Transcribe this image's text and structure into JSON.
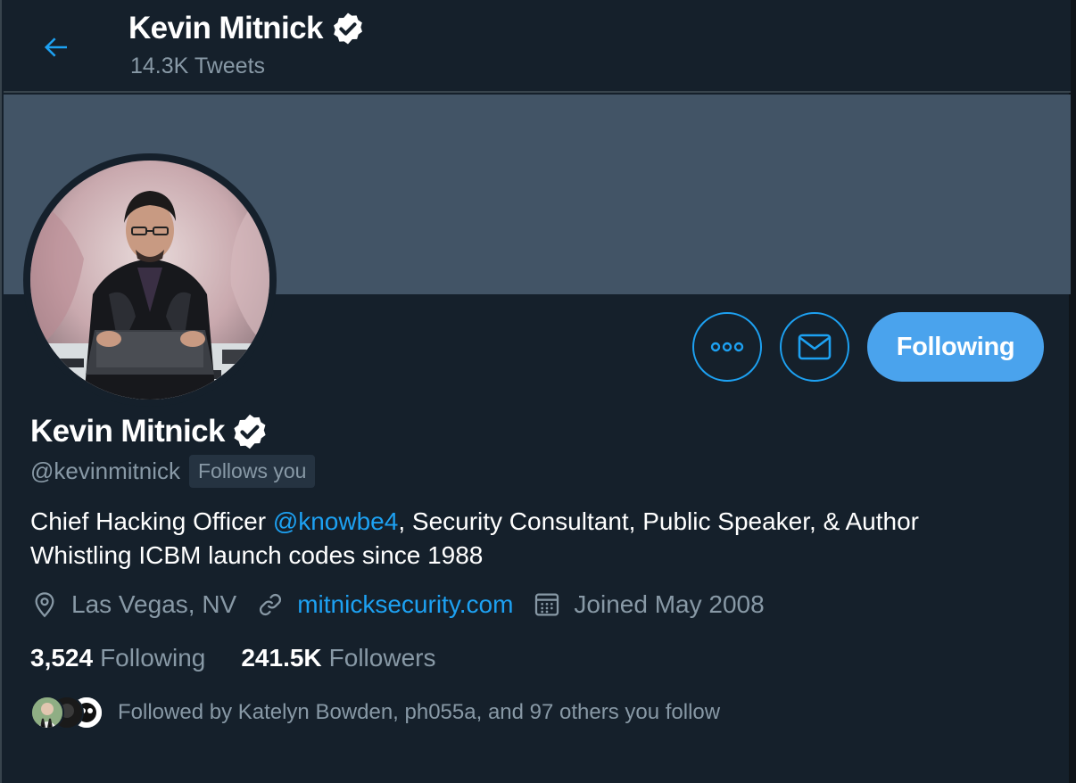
{
  "header": {
    "name": "Kevin Mitnick",
    "tweets": "14.3K Tweets"
  },
  "actions": {
    "follow_label": "Following"
  },
  "profile": {
    "name": "Kevin Mitnick",
    "handle": "@kevinmitnick",
    "follows_you": "Follows you",
    "bio_before": "Chief Hacking Officer ",
    "bio_mention": "@knowbe4",
    "bio_after": ", Security Consultant, Public Speaker, & Author",
    "bio_line2": "Whistling ICBM launch codes since 1988",
    "location": "Las Vegas, NV",
    "website": "mitnicksecurity.com",
    "joined": "Joined May 2008"
  },
  "stats": {
    "following_count": "3,524",
    "following_label": "Following",
    "followers_count": "241.5K",
    "followers_label": "Followers"
  },
  "followed_by": "Followed by Katelyn Bowden, ph055a, and 97 others you follow",
  "colors": {
    "background": "#15202b",
    "accent": "#1da1f2",
    "banner": "#425466",
    "muted": "#8899a6"
  }
}
